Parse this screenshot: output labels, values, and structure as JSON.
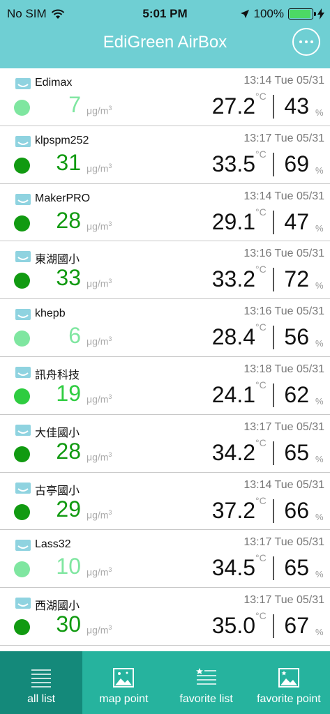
{
  "status_bar": {
    "carrier": "No SIM",
    "time": "5:01 PM",
    "battery": "100%",
    "battery_level": 1.0
  },
  "nav": {
    "title": "EdiGreen AirBox"
  },
  "units": {
    "pm_unit": "μg/m",
    "pm_unit_sup": "3",
    "temp_unit": "°C",
    "hum_unit": "%"
  },
  "colors": {
    "header": "#6fcfd3",
    "pm_low": "#7fe6a0",
    "pm_mid": "#2ecc40",
    "pm_high": "#119a11",
    "tab_bar": "#26b39e",
    "tab_active": "#14897a"
  },
  "stations": [
    {
      "name": "Edimax",
      "time": "13:14 Tue 05/31",
      "pm": "7",
      "level": "low",
      "temp": "27.2",
      "hum": "43"
    },
    {
      "name": "klpspm252",
      "time": "13:17 Tue 05/31",
      "pm": "31",
      "level": "high",
      "temp": "33.5",
      "hum": "69"
    },
    {
      "name": "MakerPRO",
      "time": "13:14 Tue 05/31",
      "pm": "28",
      "level": "high",
      "temp": "29.1",
      "hum": "47"
    },
    {
      "name": "東湖國小",
      "time": "13:16 Tue 05/31",
      "pm": "33",
      "level": "high",
      "temp": "33.2",
      "hum": "72"
    },
    {
      "name": "khepb",
      "time": "13:16 Tue 05/31",
      "pm": "6",
      "level": "low",
      "temp": "28.4",
      "hum": "56"
    },
    {
      "name": "訊舟科技",
      "time": "13:18 Tue 05/31",
      "pm": "19",
      "level": "mid",
      "temp": "24.1",
      "hum": "62"
    },
    {
      "name": "大佳國小",
      "time": "13:17 Tue 05/31",
      "pm": "28",
      "level": "high",
      "temp": "34.2",
      "hum": "65"
    },
    {
      "name": "古亭國小",
      "time": "13:14 Tue 05/31",
      "pm": "29",
      "level": "high",
      "temp": "37.2",
      "hum": "66"
    },
    {
      "name": "Lass32",
      "time": "13:17 Tue 05/31",
      "pm": "10",
      "level": "low",
      "temp": "34.5",
      "hum": "65"
    },
    {
      "name": "西湖國小",
      "time": "13:17 Tue 05/31",
      "pm": "30",
      "level": "high",
      "temp": "35.0",
      "hum": "67"
    }
  ],
  "tabs": [
    {
      "label": "all list",
      "icon": "list-icon",
      "active": true
    },
    {
      "label": "map point",
      "icon": "map-icon",
      "active": false
    },
    {
      "label": "favorite list",
      "icon": "favorite-list-icon",
      "active": false
    },
    {
      "label": "favorite point",
      "icon": "favorite-map-icon",
      "active": false
    }
  ]
}
